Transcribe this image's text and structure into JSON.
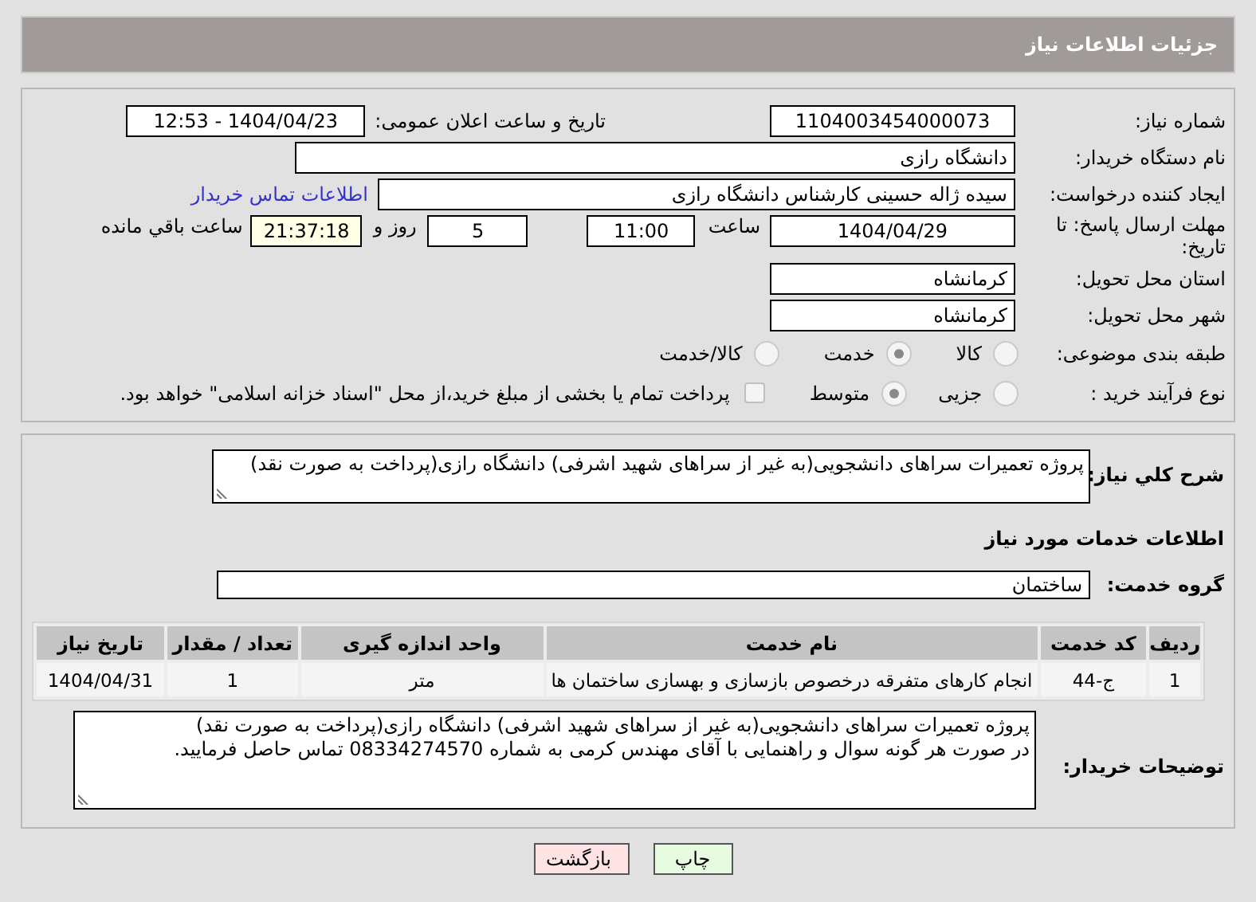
{
  "header": {
    "title": "جزئیات اطلاعات نیاز"
  },
  "need_number": {
    "label": "شماره نیاز:",
    "value": "1104003454000073"
  },
  "announce": {
    "label": "تاریخ و ساعت اعلان عمومی:",
    "value": "1404/04/23 - 12:53"
  },
  "buyer": {
    "label": "نام دستگاه خریدار:",
    "value": "دانشگاه رازی"
  },
  "creator": {
    "label": "ایجاد کننده درخواست:",
    "value": "سیده ژاله حسینی کارشناس دانشگاه رازی",
    "link": "اطلاعات تماس خریدار"
  },
  "deadline": {
    "label": "مهلت ارسال پاسخ: تا تاریخ:",
    "date": "1404/04/29",
    "time_label": "ساعت",
    "time": "11:00",
    "days": "5",
    "days_label": "روز و",
    "remaining": "21:37:18",
    "remaining_label": "ساعت باقي مانده"
  },
  "province": {
    "label": "استان محل تحویل:",
    "value": "کرمانشاه"
  },
  "city": {
    "label": "شهر محل تحویل:",
    "value": "کرمانشاه"
  },
  "category": {
    "label": "طبقه بندی موضوعی:",
    "options": [
      {
        "label": "کالا",
        "selected": false
      },
      {
        "label": "خدمت",
        "selected": true
      },
      {
        "label": "کالا/خدمت",
        "selected": false
      }
    ]
  },
  "purchase_type": {
    "label": "نوع فرآیند خرید :",
    "options": [
      {
        "label": "جزیی",
        "selected": false
      },
      {
        "label": "متوسط",
        "selected": true
      }
    ],
    "treasury": {
      "checked": false,
      "label": "پرداخت تمام یا بخشی از مبلغ خرید،از محل \"اسناد خزانه اسلامی\" خواهد بود."
    }
  },
  "description": {
    "label": "شرح کلي نیاز:",
    "value": "پروژه تعمیرات سراهای دانشجویی(به غیر از سراهای شهید اشرفی) دانشگاه رازی(پرداخت به صورت نقد)"
  },
  "services": {
    "title": "اطلاعات خدمات مورد نیاز",
    "group_label": "گروه خدمت:",
    "group": "ساختمان",
    "columns": [
      "ردیف",
      "کد خدمت",
      "نام خدمت",
      "واحد اندازه گیری",
      "تعداد / مقدار",
      "تاریخ نیاز"
    ],
    "rows": [
      [
        "1",
        "ج-44",
        "انجام کارهای متفرقه درخصوص بازسازی و بهسازی ساختمان ها",
        "متر",
        "1",
        "1404/04/31"
      ]
    ]
  },
  "buyer_notes": {
    "label": "توضیحات خریدار:",
    "lines": [
      "پروژه تعمیرات سراهای دانشجویی(به غیر از سراهای شهید اشرفی) دانشگاه رازی(پرداخت به صورت نقد)",
      "در صورت هر گونه سوال و راهنمایی با آقای مهندس کرمی به شماره 08334274570 تماس حاصل فرمایید."
    ]
  },
  "buttons": [
    {
      "label": "چاپ",
      "kind": "print"
    },
    {
      "label": "بازگشت",
      "kind": "back"
    }
  ]
}
